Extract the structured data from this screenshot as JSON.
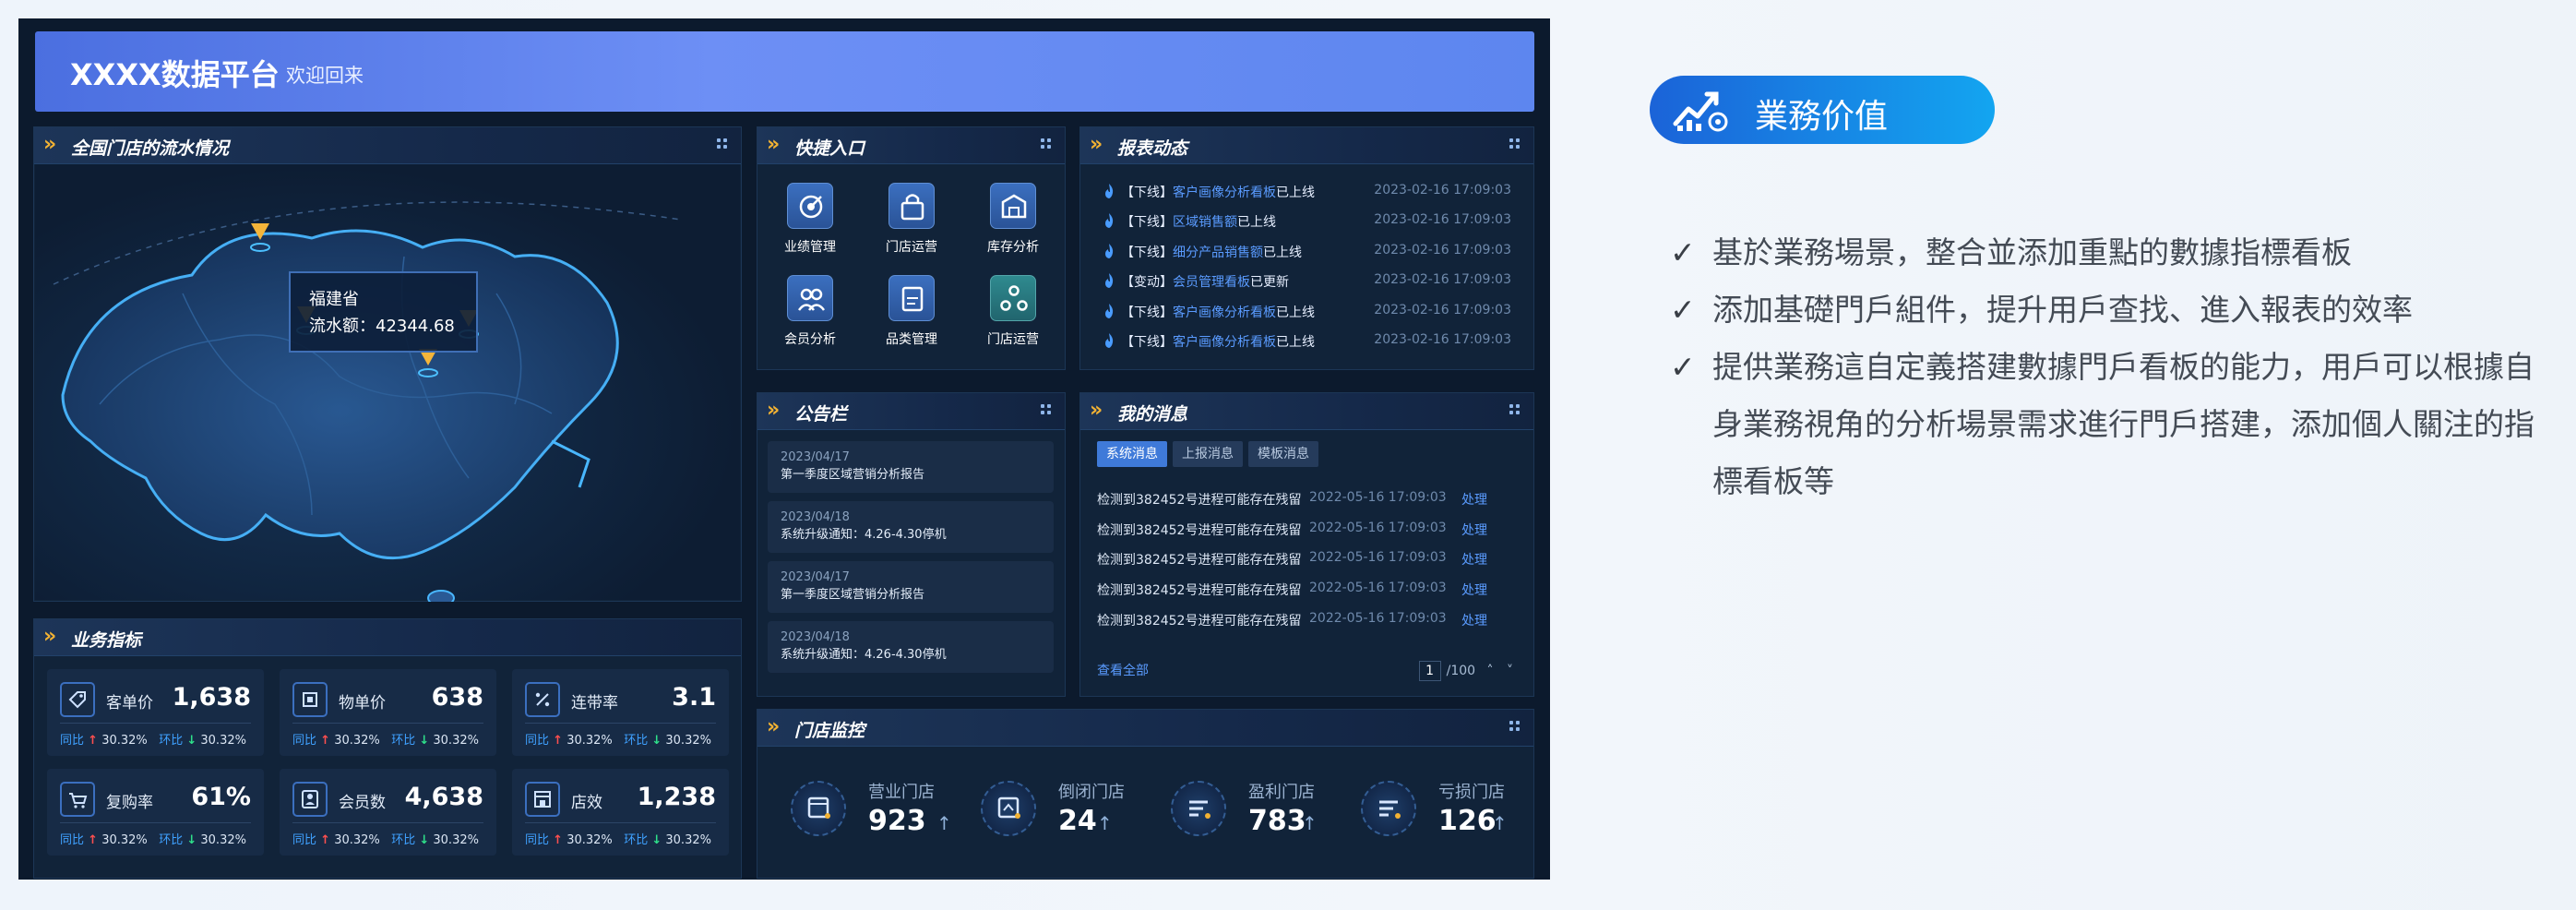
{
  "app": {
    "brand": "XXXX数据平台",
    "welcome": "欢迎回来"
  },
  "map_panel": {
    "title": "全国门店的流水情况",
    "tooltip_province": "福建省",
    "tooltip_flow": "流水额：42344.68",
    "pins": 4
  },
  "quick": {
    "title": "快捷入口",
    "items": [
      {
        "label": "业绩管理",
        "icon": "target-icon"
      },
      {
        "label": "门店运营",
        "icon": "bag-icon"
      },
      {
        "label": "库存分析",
        "icon": "warehouse-icon"
      },
      {
        "label": "会员分析",
        "icon": "users-icon"
      },
      {
        "label": "品类管理",
        "icon": "document-icon"
      },
      {
        "label": "门店运营",
        "icon": "nodes-icon"
      }
    ]
  },
  "report": {
    "title": "报表动态",
    "rows": [
      {
        "tag": "【下线】",
        "name": "客户画像分析看板",
        "status": "已上线",
        "time": "2023-02-16 17:09:03"
      },
      {
        "tag": "【下线】",
        "name": "区域销售额",
        "status": "已上线",
        "time": "2023-02-16 17:09:03"
      },
      {
        "tag": "【下线】",
        "name": "细分产品销售额",
        "status": "已上线",
        "time": "2023-02-16 17:09:03"
      },
      {
        "tag": "【变动】",
        "name": "会员管理看板",
        "status": "已更新",
        "time": "2023-02-16 17:09:03"
      },
      {
        "tag": "【下线】",
        "name": "客户画像分析看板",
        "status": "已上线",
        "time": "2023-02-16 17:09:03"
      },
      {
        "tag": "【下线】",
        "name": "客户画像分析看板",
        "status": "已上线",
        "time": "2023-02-16 17:09:03"
      }
    ]
  },
  "notice": {
    "title": "公告栏",
    "items": [
      {
        "date": "2023/04/17",
        "text": "第一季度区域营销分析报告"
      },
      {
        "date": "2023/04/18",
        "text": "系统升级通知：4.26-4.30停机"
      },
      {
        "date": "2023/04/17",
        "text": "第一季度区域营销分析报告"
      },
      {
        "date": "2023/04/18",
        "text": "系统升级通知：4.26-4.30停机"
      }
    ]
  },
  "messages": {
    "title": "我的消息",
    "tabs": [
      "系统消息",
      "上报消息",
      "模板消息"
    ],
    "rows": [
      {
        "text": "检测到382452号进程可能存在残留",
        "time": "2022-05-16 17:09:03",
        "action": "处理"
      },
      {
        "text": "检测到382452号进程可能存在残留",
        "time": "2022-05-16 17:09:03",
        "action": "处理"
      },
      {
        "text": "检测到382452号进程可能存在残留",
        "time": "2022-05-16 17:09:03",
        "action": "处理"
      },
      {
        "text": "检测到382452号进程可能存在残留",
        "time": "2022-05-16 17:09:03",
        "action": "处理"
      },
      {
        "text": "检测到382452号进程可能存在残留",
        "time": "2022-05-16 17:09:03",
        "action": "处理"
      }
    ],
    "view_all": "查看全部",
    "page": "1",
    "total": "/100"
  },
  "kpi": {
    "title": "业务指标",
    "yoy_label": "同比",
    "mom_label": "环比",
    "items": [
      {
        "label": "客单价",
        "value": "1,638",
        "yoy": "30.32%",
        "mom": "30.32%",
        "icon": "tag-icon"
      },
      {
        "label": "物单价",
        "value": "638",
        "yoy": "30.32%",
        "mom": "30.32%",
        "icon": "item-icon"
      },
      {
        "label": "连带率",
        "value": "3.1",
        "yoy": "30.32%",
        "mom": "30.32%",
        "icon": "percent-icon"
      },
      {
        "label": "复购率",
        "value": "61%",
        "yoy": "30.32%",
        "mom": "30.32%",
        "icon": "cart-icon"
      },
      {
        "label": "会员数",
        "value": "4,638",
        "yoy": "30.32%",
        "mom": "30.32%",
        "icon": "member-icon"
      },
      {
        "label": "店效",
        "value": "1,238",
        "yoy": "30.32%",
        "mom": "30.32%",
        "icon": "store-icon"
      }
    ]
  },
  "monitor": {
    "title": "门店监控",
    "items": [
      {
        "label": "营业门店",
        "value": "923"
      },
      {
        "label": "倒闭门店",
        "value": "24"
      },
      {
        "label": "盈利门店",
        "value": "783"
      },
      {
        "label": "亏损门店",
        "value": "126"
      }
    ]
  },
  "value": {
    "title": "業務价值",
    "bullets": [
      "基於業務場景，整合並添加重點的數據指標看板",
      "添加基礎門戶組件，提升用戶查找、進入報表的效率",
      "提供業務這自定義搭建數據門戶看板的能力，用戶可以根據自身業務視角的分析場景需求進行門戶搭建，添加個人關注的指標看板等"
    ]
  },
  "colors": {
    "accent_blue": "#3f7ad9",
    "up_red": "#ff4f4f",
    "down_green": "#2ee08a",
    "chevron_gold": "#f2b233"
  }
}
